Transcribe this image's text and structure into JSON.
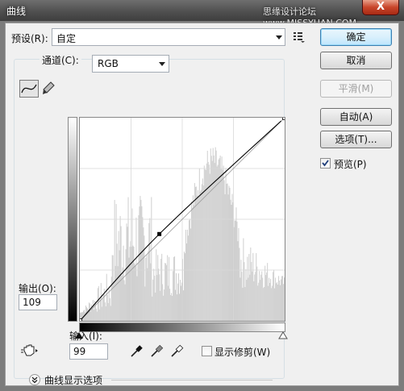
{
  "window": {
    "title": "曲线",
    "watermark": "思缘设计论坛 www.MISSYUAN.COM",
    "close_label": "X"
  },
  "preset": {
    "label": "预设(R):",
    "value": "自定"
  },
  "channel": {
    "label": "通道(C):",
    "value": "RGB"
  },
  "output": {
    "label": "输出(O):",
    "value": "109"
  },
  "input": {
    "label": "输入(I):",
    "value": "99"
  },
  "clipping": {
    "label": "显示修剪(W)",
    "checked": false
  },
  "curve_options": {
    "label": "曲线显示选项"
  },
  "buttons": {
    "ok": "确定",
    "cancel": "取消",
    "smooth": "平滑(M)",
    "auto": "自动(A)",
    "options": "选项(T)..."
  },
  "preview": {
    "label": "预览(P)",
    "checked": true
  },
  "icons": {
    "preset_menu": "preset-options-icon",
    "curve_tool": "curve-point-tool-icon",
    "pencil_tool": "pencil-tool-icon",
    "hand_tool": "on-image-adjust-icon",
    "black_eyedropper": "black-point-eyedropper-icon",
    "gray_eyedropper": "gray-point-eyedropper-icon",
    "white_eyedropper": "white-point-eyedropper-icon",
    "expand": "expand-chevron-icon"
  },
  "chart_data": {
    "type": "line",
    "x_range": [
      0,
      255
    ],
    "y_range": [
      0,
      255
    ],
    "grid": true,
    "grid_divisions": 4,
    "series": [
      {
        "values": [
          [
            0,
            0
          ],
          [
            99,
            109
          ],
          [
            255,
            255
          ]
        ]
      }
    ],
    "baseline": [
      [
        0,
        0
      ],
      [
        255,
        255
      ]
    ],
    "control_point": [
      99,
      109
    ]
  }
}
